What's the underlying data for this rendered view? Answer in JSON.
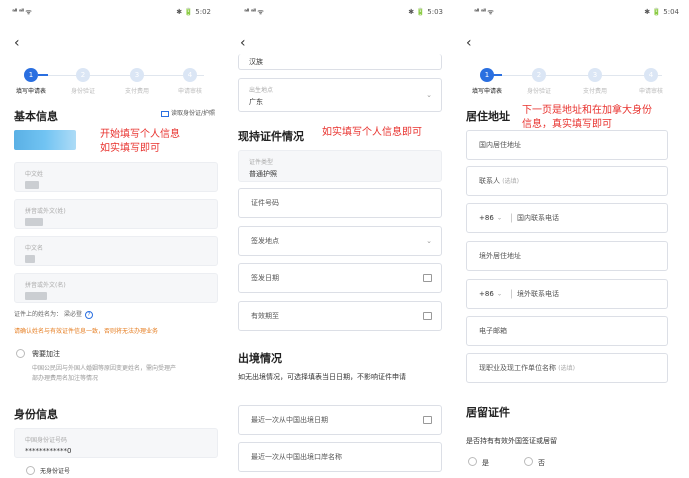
{
  "statusbar": [
    {
      "signal": "ᵃˡˡ ᵃˡˡ ᯤ",
      "right": "✱ 🔋 5:02"
    },
    {
      "signal": "ᵃˡˡ ᵃˡˡ ᯤ",
      "right": "✱ 🔋 5:03"
    },
    {
      "signal": "ᵃˡˡ ᵃˡˡ ᯤ",
      "right": "✱ 🔋 5:04"
    }
  ],
  "steps": [
    "填写申请表",
    "身份验证",
    "支付费用",
    "申请审核"
  ],
  "panel1": {
    "section_basic": "基本信息",
    "scan_label": "读取身份证/护照",
    "note": "开始填写个人信息\n如实填写即可",
    "fields": [
      {
        "label": "中文姓"
      },
      {
        "label": "拼音或外文(姓)"
      },
      {
        "label": "中文名"
      },
      {
        "label": "拼音或外文(名)"
      }
    ],
    "name_on_id_label": "证件上的姓名为：",
    "name_on_id_value": "梁必登",
    "help": "?",
    "warning": "请确认姓名与有效证件信息一致，否则将无法办理业务",
    "checkbox_label": "需要加注",
    "hint": "中国公民因与外国人婚姻等原因变更姓名，需向受理产\n部办理费用名加注等情况",
    "section_id": "身份信息",
    "id_label": "中国身份证号码",
    "id_value": "************0",
    "no_id": "无身份证号"
  },
  "panel2": {
    "top_value": "汉族",
    "birth_label": "出生地点",
    "birth_value": "广东",
    "section": "现持证件情况",
    "note": "如实填写个人信息即可",
    "cert_type_label": "证件类型",
    "cert_type_value": "普通护照",
    "cert_no": "证件号码",
    "issue_place": "签发地点",
    "issue_date": "签发日期",
    "expiry": "有效期至",
    "section_exit": "出境情况",
    "exit_note": "如无出境情况，可选择填表当日日期，不影响证件申请",
    "last_exit_date": "最近一次从中国出境日期",
    "last_exit_port": "最近一次从中国出境口岸名称"
  },
  "panel3": {
    "section": "居住地址",
    "note": "下一页是地址和在加拿大身份\n信息，真实填写即可",
    "domestic_addr": "国内居住地址",
    "contact": "联系人",
    "contact_opt": "(选填)",
    "cc1": "+86",
    "domestic_phone": "国内联系电话",
    "overseas_addr": "境外居住地址",
    "cc2": "+86",
    "overseas_phone": "境外联系电话",
    "email": "电子邮箱",
    "job": "现职业及现工作单位名称",
    "job_opt": "(选填)",
    "section_residence": "居留证件",
    "residence_q": "是否持有有效外国签证或居留",
    "yes": "是",
    "no": "否"
  },
  "colors": {
    "accent": "#2a6fe0",
    "note": "#e8322e",
    "warning": "#e67e22"
  }
}
